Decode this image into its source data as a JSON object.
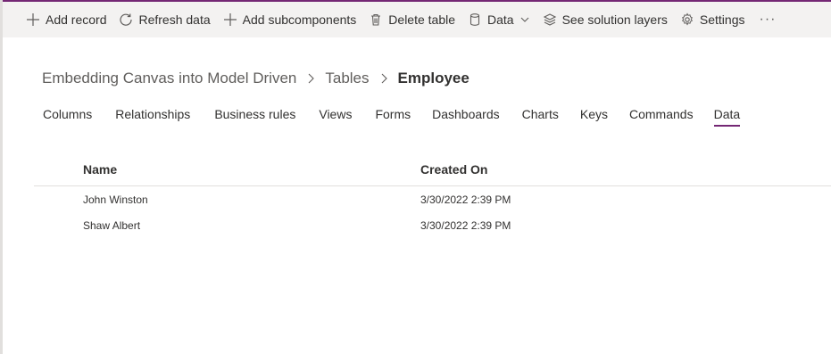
{
  "colors": {
    "accent": "#742774",
    "toolbar_bg": "#f3f2f1",
    "text": "#323130",
    "subtle_text": "#605e5c",
    "divider": "#e1dfdd"
  },
  "toolbar": {
    "items": [
      {
        "label": "Add record",
        "icon": "plus-icon"
      },
      {
        "label": "Refresh data",
        "icon": "refresh-icon"
      },
      {
        "label": "Add subcomponents",
        "icon": "plus-icon"
      },
      {
        "label": "Delete table",
        "icon": "trash-icon"
      },
      {
        "label": "Data",
        "icon": "database-icon",
        "has_dropdown": true
      },
      {
        "label": "See solution layers",
        "icon": "layers-icon"
      },
      {
        "label": "Settings",
        "icon": "gear-icon"
      }
    ],
    "more_label": "···"
  },
  "breadcrumb": {
    "solution": "Embedding Canvas into Model Driven",
    "tables": "Tables",
    "current": "Employee"
  },
  "tabs": [
    {
      "label": "Columns"
    },
    {
      "label": "Relationships"
    },
    {
      "label": "Business rules"
    },
    {
      "label": "Views"
    },
    {
      "label": "Forms"
    },
    {
      "label": "Dashboards"
    },
    {
      "label": "Charts"
    },
    {
      "label": "Keys"
    },
    {
      "label": "Commands"
    },
    {
      "label": "Data",
      "active": true
    }
  ],
  "grid": {
    "columns": {
      "name": "Name",
      "created_on": "Created On"
    },
    "rows": [
      {
        "name": "John Winston",
        "created_on": "3/30/2022 2:39 PM"
      },
      {
        "name": "Shaw Albert",
        "created_on": "3/30/2022 2:39 PM"
      }
    ]
  }
}
